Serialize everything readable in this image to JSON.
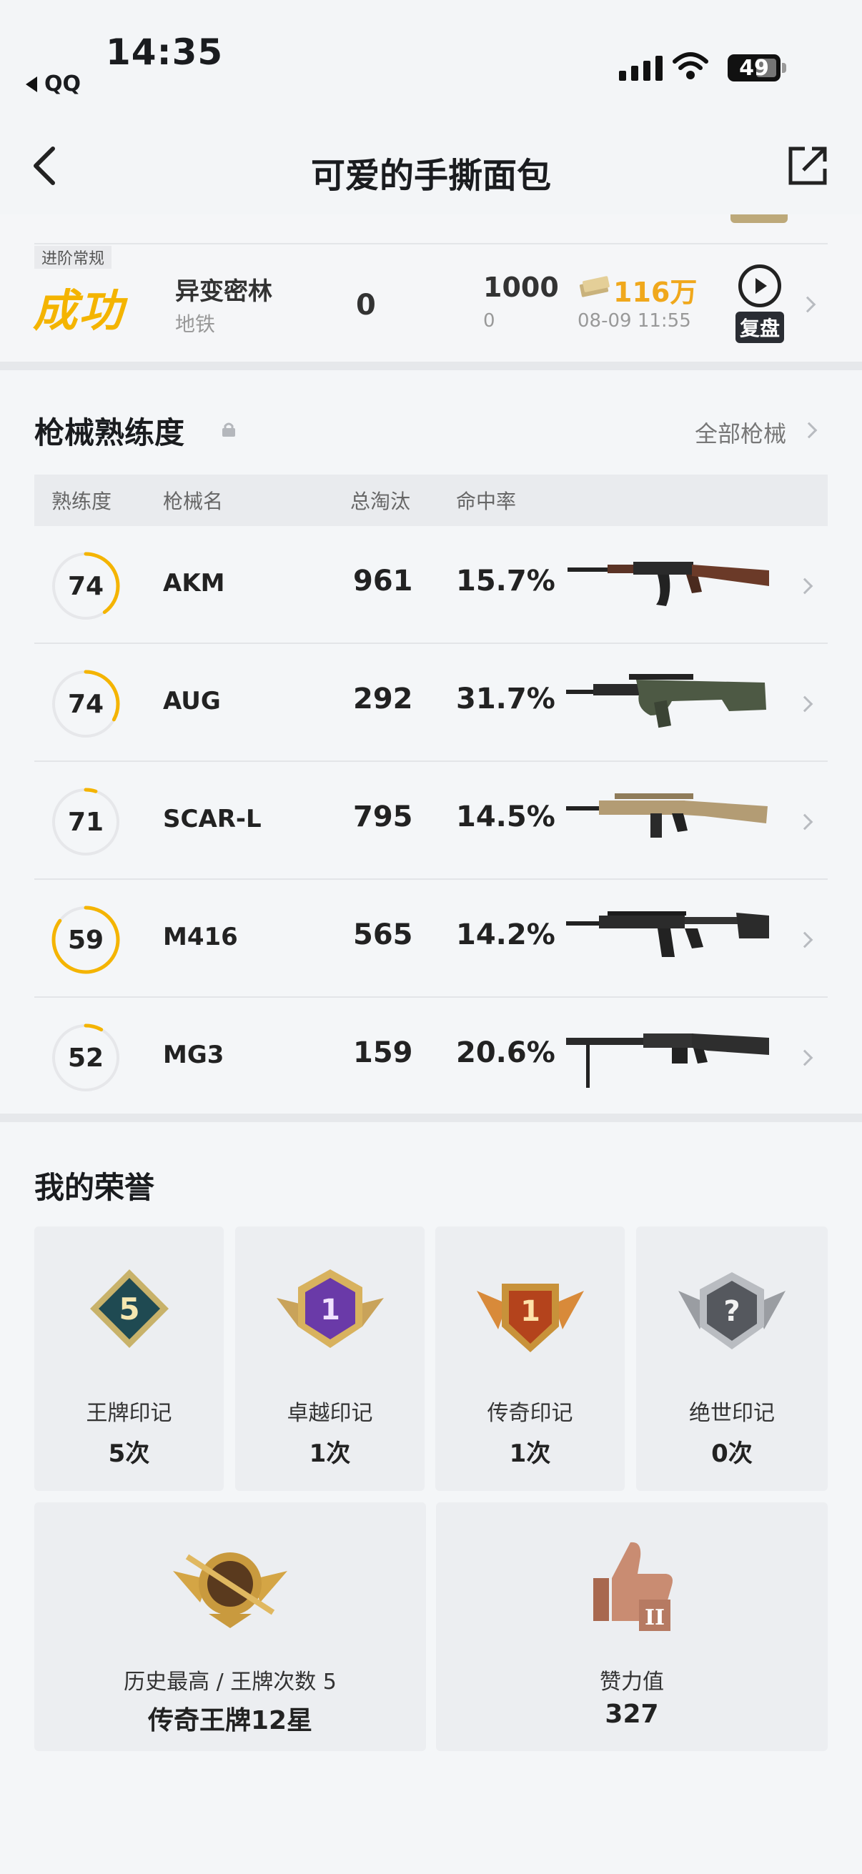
{
  "status_bar": {
    "time": "14:35",
    "back_app": "QQ",
    "battery": "49"
  },
  "nav": {
    "title": "可爱的手撕面包"
  },
  "match": {
    "mode_tag": "进阶常规",
    "result": "成功",
    "map": "异变密林",
    "map_sub": "地铁",
    "kills": "0",
    "score": "1000",
    "score_sub": "0",
    "money": "116万",
    "date": "08-09 11:55",
    "replay_label": "复盘"
  },
  "mastery": {
    "title": "枪械熟练度",
    "all_label": "全部枪械",
    "headers": {
      "level": "熟练度",
      "name": "枪械名",
      "kills": "总淘汰",
      "accuracy": "命中率"
    },
    "rows": [
      {
        "level": "74",
        "name": "AKM",
        "kills": "961",
        "accuracy": "15.7%",
        "progress": 0.4
      },
      {
        "level": "74",
        "name": "AUG",
        "kills": "292",
        "accuracy": "31.7%",
        "progress": 0.33
      },
      {
        "level": "71",
        "name": "SCAR-L",
        "kills": "795",
        "accuracy": "14.5%",
        "progress": 0.05
      },
      {
        "level": "59",
        "name": "M416",
        "kills": "565",
        "accuracy": "14.2%",
        "progress": 0.85
      },
      {
        "level": "52",
        "name": "MG3",
        "kills": "159",
        "accuracy": "20.6%",
        "progress": 0.08
      }
    ],
    "ring_color": "#f4b400"
  },
  "honors": {
    "title": "我的荣誉",
    "items": [
      {
        "label": "王牌印记",
        "value": "5次",
        "badge": "5"
      },
      {
        "label": "卓越印记",
        "value": "1次",
        "badge": "1"
      },
      {
        "label": "传奇印记",
        "value": "1次",
        "badge": "1"
      },
      {
        "label": "绝世印记",
        "value": "0次",
        "badge": "?"
      }
    ],
    "history": {
      "label": "历史最高 / 王牌次数 5",
      "value": "传奇王牌12星"
    },
    "likes": {
      "label": "赞力值",
      "value": "327"
    }
  }
}
